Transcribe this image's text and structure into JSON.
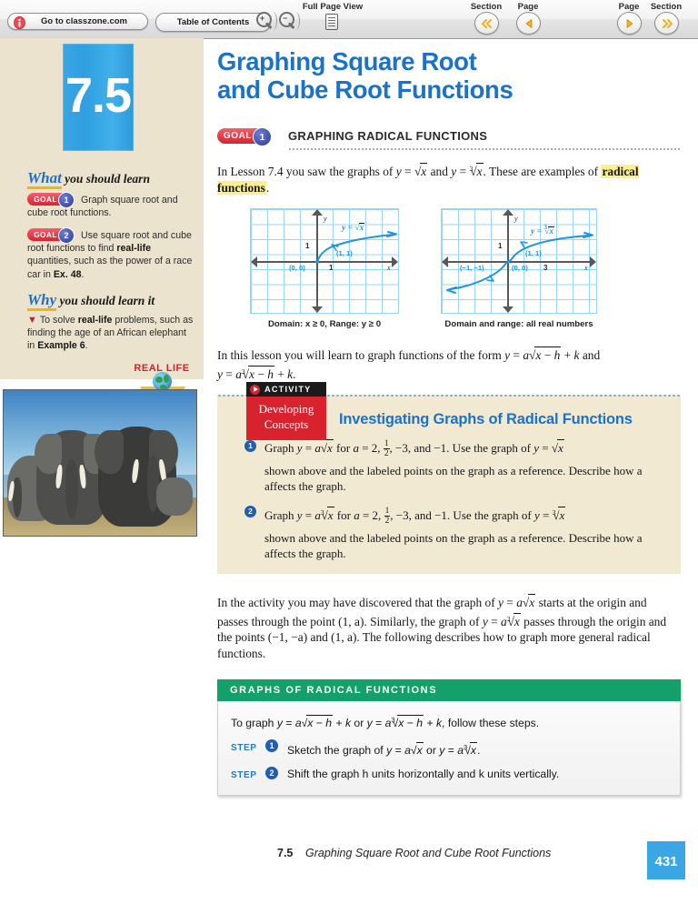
{
  "toolbar": {
    "classzone_label": "Go to classzone.com",
    "toc_label": "Table of Contents",
    "fullpage_label": "Full Page View",
    "section_prev_label": "Section",
    "page_prev_label": "Page",
    "page_next_label": "Page",
    "section_next_label": "Section",
    "zoom_in_sign": "+",
    "zoom_out_sign": "−"
  },
  "sidebar": {
    "lesson_number": "7.5",
    "what_head_accent": "What",
    "what_head_rest": " you should learn",
    "why_head_accent": "Why",
    "why_head_rest": " you should learn it",
    "goals": [
      {
        "chip": "GOAL",
        "num": "1",
        "text_a": "Graph square root and cube root functions.",
        "bold_a": "",
        "text_b": ""
      },
      {
        "chip": "GOAL",
        "num": "2",
        "text_a": "Use square root and cube root functions to find ",
        "bold_a": "real-life",
        "text_b": " quantities, such as the power of a race car in ",
        "bold_b": "Ex. 48",
        "text_c": "."
      }
    ],
    "why_text_a": "To solve ",
    "why_bold_a": "real-life",
    "why_text_b": " problems, such as finding the age of an African elephant in ",
    "why_bold_b": "Example 6",
    "why_text_c": ".",
    "reallife_badge": "REAL LIFE"
  },
  "main": {
    "title_line1": "Graphing Square Root",
    "title_line2": "and Cube Root Functions",
    "goal_chip": "GOAL",
    "goal_num": "1",
    "goal_heading": "GRAPHING RADICAL FUNCTIONS",
    "intro_a": "In Lesson 7.4 you saw the graphs of ",
    "intro_eq1": "y = √x",
    "intro_b": " and ",
    "intro_eq2": "y = ∛̅x",
    "intro_c": ". These are examples of ",
    "intro_highlight": "radical functions",
    "intro_d": ".",
    "lesson_text_a": "In this lesson you will learn to graph functions of the form ",
    "lesson_eq1": "y = a√(x − h) + k",
    "lesson_text_b": " and ",
    "lesson_eq2": "y = a∛(x − h) + k.",
    "discover_a": "In the activity you may have discovered that the graph of ",
    "discover_eq1": "y = a√x",
    "discover_b": " starts at the origin and passes through the point (1, a). Similarly, the graph of ",
    "discover_eq2": "y = a∛̅x",
    "discover_c": " passes through the origin and the points (−1, −a) and (1, a). The following describes how to graph more general radical functions."
  },
  "chart_data": [
    {
      "type": "line",
      "title": "y = √x",
      "caption": "Domain: x ≥ 0, Range: y ≥ 0",
      "equation_label": "y = √x",
      "xlabel": "x",
      "ylabel": "y",
      "xlim": [
        -4,
        5
      ],
      "ylim": [
        -4,
        3
      ],
      "grid": true,
      "x_ticks": [
        "1"
      ],
      "y_ticks": [
        "1"
      ],
      "annotations": [
        "(0, 0)",
        "(1, 1)"
      ],
      "points": [
        [
          0,
          0
        ],
        [
          0.25,
          0.5
        ],
        [
          1,
          1
        ],
        [
          2,
          1.41
        ],
        [
          3,
          1.73
        ],
        [
          4,
          2
        ],
        [
          5,
          2.24
        ]
      ]
    },
    {
      "type": "line",
      "title": "y = ∛̅x",
      "caption": "Domain and range: all real numbers",
      "equation_label": "y = ∛̅x",
      "xlabel": "x",
      "ylabel": "y",
      "xlim": [
        -4,
        5
      ],
      "ylim": [
        -4,
        3
      ],
      "grid": true,
      "x_ticks": [
        "3"
      ],
      "y_ticks": [
        "1"
      ],
      "annotations": [
        "(−1, −1)",
        "(0, 0)",
        "(1, 1)"
      ],
      "points": [
        [
          -4,
          -1.59
        ],
        [
          -3,
          -1.44
        ],
        [
          -2,
          -1.26
        ],
        [
          -1,
          -1
        ],
        [
          0,
          0
        ],
        [
          1,
          1
        ],
        [
          2,
          1.26
        ],
        [
          3,
          1.44
        ],
        [
          4,
          1.59
        ]
      ]
    }
  ],
  "activity": {
    "tab_label": "ACTIVITY",
    "red_line1": "Developing",
    "red_line2": "Concepts",
    "title": "Investigating Graphs of Radical Functions",
    "items": [
      {
        "num": "1",
        "line1_a": "Graph ",
        "line1_eq": "y = a√x",
        "line1_b": " for a = 2, 1/2, −3, and −1. Use the graph of ",
        "line1_eq2": "y = √x",
        "line2": "shown above and the labeled points on the graph as a reference. Describe how a affects the graph."
      },
      {
        "num": "2",
        "line1_a": "Graph ",
        "line1_eq": "y = a∛̅x",
        "line1_b": " for a = 2, 1/2, −3, and −1. Use the graph of ",
        "line1_eq2": "y = ∛̅x",
        "line2": "shown above and the labeled points on the graph as a reference. Describe how a affects the graph."
      }
    ]
  },
  "summary": {
    "heading": "GRAPHS OF RADICAL FUNCTIONS",
    "intro_a": "To graph ",
    "intro_eq1": "y = a√(x − h) + k",
    "intro_b": " or ",
    "intro_eq2": "y = a∛(x − h) + k",
    "intro_c": ", follow these steps.",
    "steps": [
      {
        "tag": "STEP",
        "num": "1",
        "text_a": "Sketch the graph of ",
        "eq1": "y = a√x",
        "text_b": " or ",
        "eq2": "y = a∛̅x",
        "text_c": "."
      },
      {
        "tag": "STEP",
        "num": "2",
        "text_a": "Shift the graph h units horizontally and k units vertically.",
        "eq1": "",
        "text_b": "",
        "eq2": "",
        "text_c": ""
      }
    ]
  },
  "footer": {
    "lesson": "7.5",
    "title": "Graphing Square Root and Cube Root Functions",
    "page_number": "431"
  },
  "colors": {
    "brand_blue": "#1c72c4",
    "lesson_blue": "#3aa6e4",
    "goal_red": "#d8232f",
    "goal_navy": "#2c3a96",
    "summary_green": "#13a06b",
    "sidebar_beige": "#ece3ce",
    "activity_beige": "#f2e9d3",
    "highlight_yellow": "#fbf08c",
    "graph_blue": "#2196d8"
  }
}
